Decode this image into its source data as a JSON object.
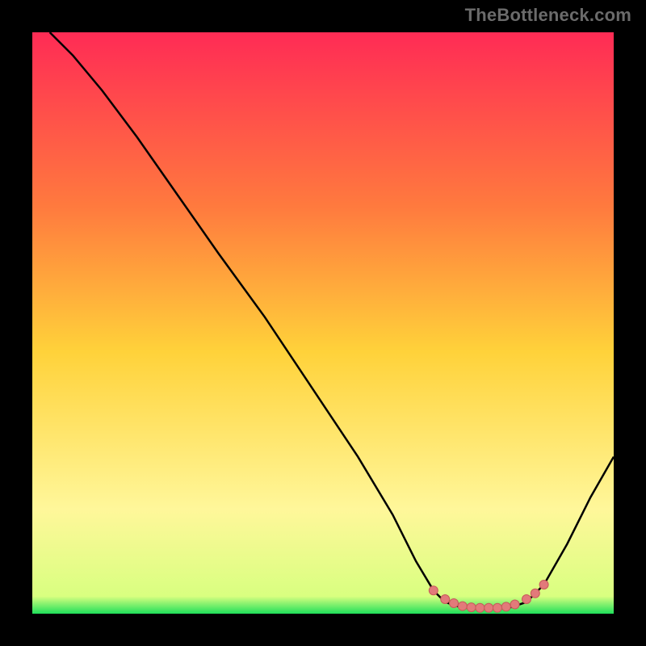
{
  "watermark": "TheBottleneck.com",
  "colors": {
    "background": "#000000",
    "curve": "#000000",
    "marker_fill": "#e27a7a",
    "marker_stroke": "#c85a5a",
    "grad_top": "#ff2b55",
    "grad_mid_upper": "#ff7a3e",
    "grad_mid": "#ffd23a",
    "grad_lower": "#fff79a",
    "grad_bottom": "#1fe05a"
  },
  "chart_data": {
    "type": "line",
    "title": "",
    "xlabel": "",
    "ylabel": "",
    "xlim": [
      0,
      100
    ],
    "ylim": [
      0,
      100
    ],
    "curve": [
      {
        "x": 3,
        "y": 100
      },
      {
        "x": 7,
        "y": 96
      },
      {
        "x": 12,
        "y": 90
      },
      {
        "x": 18,
        "y": 82
      },
      {
        "x": 25,
        "y": 72
      },
      {
        "x": 32,
        "y": 62
      },
      {
        "x": 40,
        "y": 51
      },
      {
        "x": 48,
        "y": 39
      },
      {
        "x": 56,
        "y": 27
      },
      {
        "x": 62,
        "y": 17
      },
      {
        "x": 66,
        "y": 9
      },
      {
        "x": 69,
        "y": 4
      },
      {
        "x": 71,
        "y": 2
      },
      {
        "x": 74,
        "y": 1
      },
      {
        "x": 78,
        "y": 1
      },
      {
        "x": 82,
        "y": 1
      },
      {
        "x": 85,
        "y": 2
      },
      {
        "x": 88,
        "y": 5
      },
      {
        "x": 92,
        "y": 12
      },
      {
        "x": 96,
        "y": 20
      },
      {
        "x": 100,
        "y": 27
      }
    ],
    "markers": [
      {
        "x": 69,
        "y": 4
      },
      {
        "x": 71,
        "y": 2.5
      },
      {
        "x": 72.5,
        "y": 1.8
      },
      {
        "x": 74,
        "y": 1.3
      },
      {
        "x": 75.5,
        "y": 1.1
      },
      {
        "x": 77,
        "y": 1
      },
      {
        "x": 78.5,
        "y": 1
      },
      {
        "x": 80,
        "y": 1
      },
      {
        "x": 81.5,
        "y": 1.2
      },
      {
        "x": 83,
        "y": 1.6
      },
      {
        "x": 85,
        "y": 2.5
      },
      {
        "x": 86.5,
        "y": 3.5
      },
      {
        "x": 88,
        "y": 5
      }
    ]
  }
}
